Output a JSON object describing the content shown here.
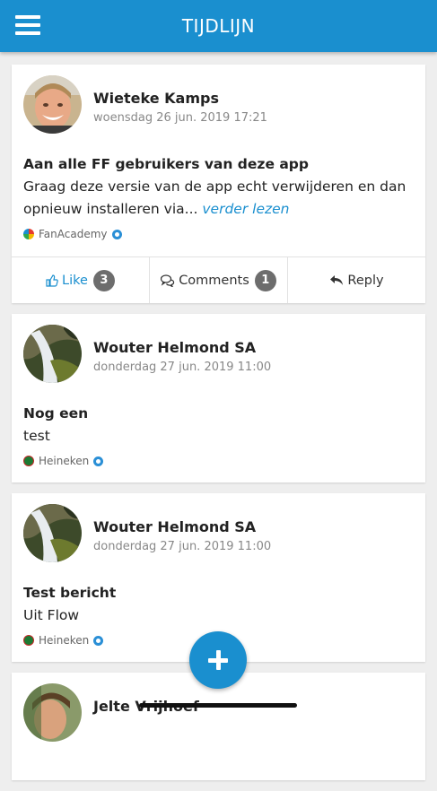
{
  "header": {
    "title": "TIJDLIJN",
    "menu_icon": "hamburger-menu-icon"
  },
  "posts": [
    {
      "author": "Wieteke Kamps",
      "date": "woensdag 26 jun. 2019 17:21",
      "title": "Aan alle FF gebruikers van deze app",
      "text": "Graag deze versie van de app echt verwijderen en dan opnieuw installeren via...",
      "read_more": "verder lezen",
      "source": "FanAcademy",
      "actions": {
        "like_label": "Like",
        "like_count": "3",
        "comments_label": "Comments",
        "comments_count": "1",
        "reply_label": "Reply"
      }
    },
    {
      "author": "Wouter Helmond SA",
      "date": "donderdag 27 jun. 2019 11:00",
      "title": "Nog een",
      "text": "test",
      "source": "Heineken"
    },
    {
      "author": "Wouter Helmond SA",
      "date": "donderdag 27 jun. 2019 11:00",
      "title": "Test bericht",
      "text": "Uit Flow",
      "source": "Heineken"
    },
    {
      "author": "Jelte Vrijhoef"
    }
  ],
  "colors": {
    "accent": "#1a8fcf",
    "badge": "#6d6d6d"
  }
}
